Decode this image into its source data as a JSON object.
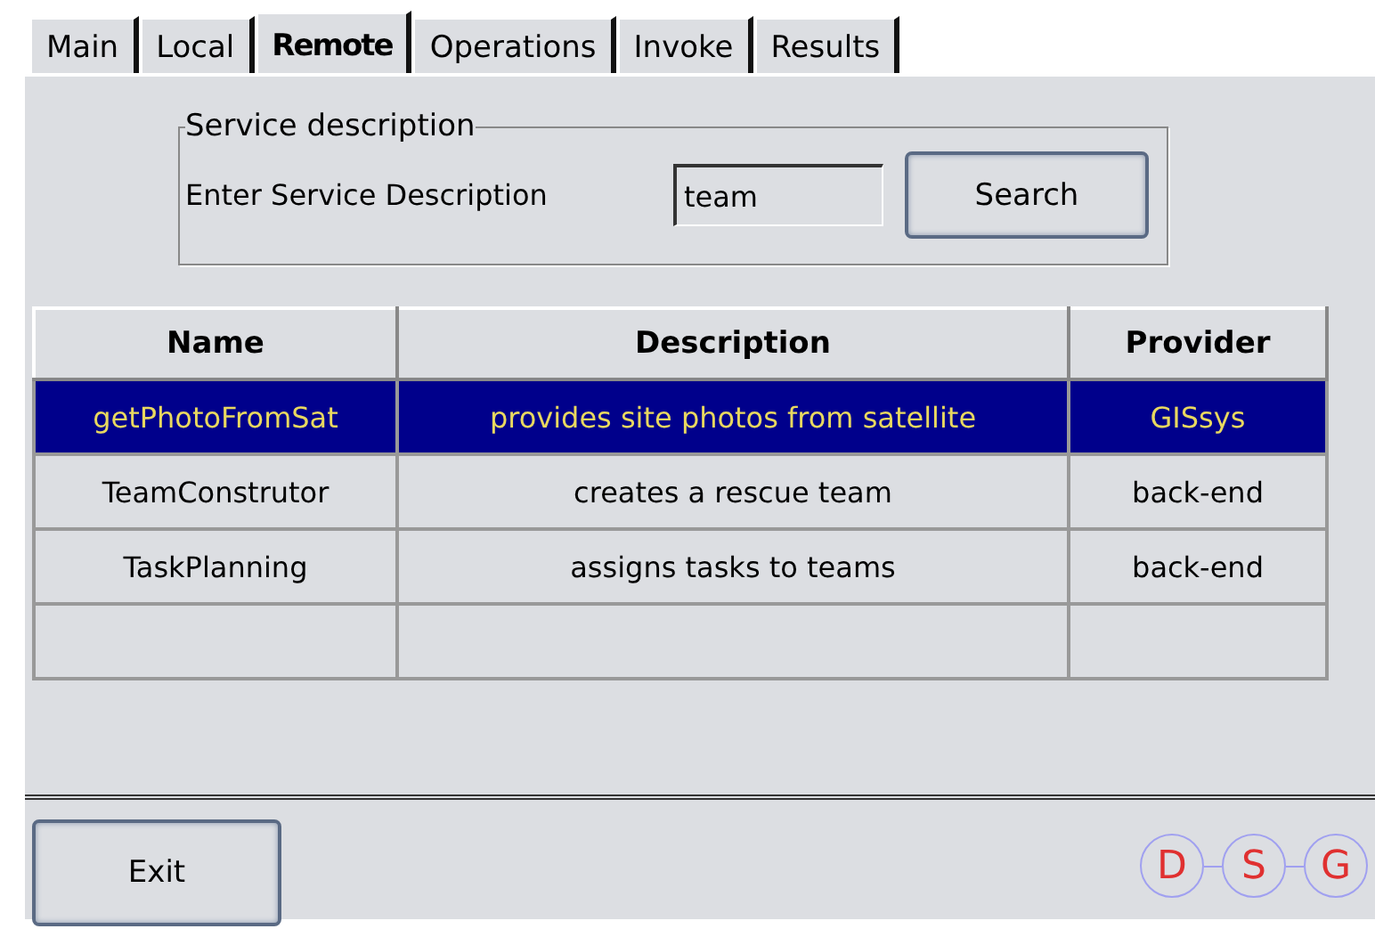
{
  "tabs": [
    {
      "label": "Main",
      "selected": false
    },
    {
      "label": "Local",
      "selected": false
    },
    {
      "label": "Remote",
      "selected": true
    },
    {
      "label": "Operations",
      "selected": false
    },
    {
      "label": "Invoke",
      "selected": false
    },
    {
      "label": "Results",
      "selected": false
    }
  ],
  "service_group": {
    "title": "Service description",
    "label": "Enter Service Description",
    "field_value": "team",
    "button": "Search"
  },
  "table": {
    "columns": [
      "Name",
      "Description",
      "Provider"
    ],
    "rows": [
      {
        "cells": [
          "getPhotoFromSat",
          "provides site photos from satellite",
          "GISsys"
        ],
        "selected": true
      },
      {
        "cells": [
          "TeamConstrutor",
          "creates a rescue team",
          "back-end"
        ],
        "selected": false
      },
      {
        "cells": [
          "TaskPlanning",
          "assigns tasks to teams",
          "back-end"
        ],
        "selected": false
      },
      {
        "cells": [],
        "selected": false
      }
    ]
  },
  "exit_button": "Exit",
  "logo_letters": [
    "D",
    "S",
    "G"
  ]
}
